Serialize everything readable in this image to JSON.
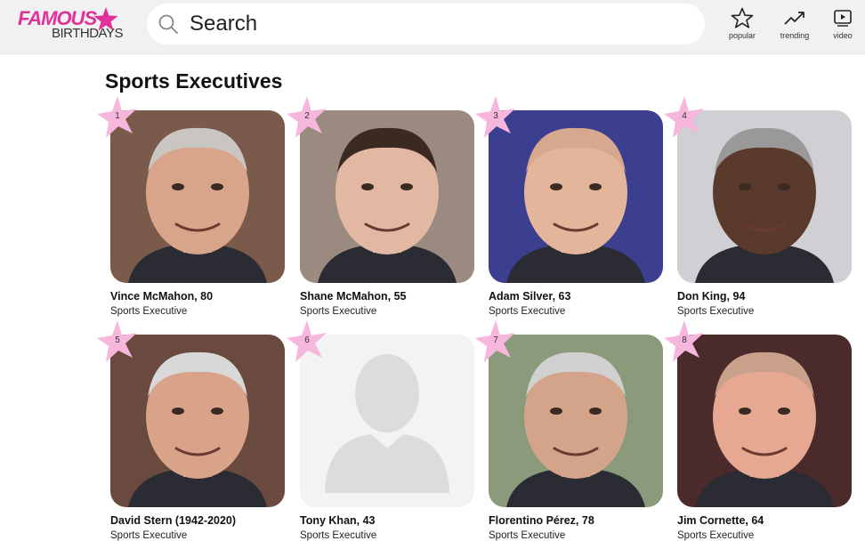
{
  "header": {
    "logo_top": "FAMOUS",
    "logo_bottom": "BIRTHDAYS",
    "search_placeholder": "Search",
    "nav": [
      {
        "label": "popular",
        "icon": "star-outline-icon"
      },
      {
        "label": "trending",
        "icon": "trending-up-icon"
      },
      {
        "label": "video",
        "icon": "play-video-icon"
      }
    ]
  },
  "colors": {
    "brand_pink": "#e0329a",
    "star_pink": "#f7b6dc",
    "header_bg": "#f1f1f1"
  },
  "main": {
    "title": "Sports Executives",
    "people": [
      {
        "rank": "1",
        "name": "Vince McMahon, 80",
        "role": "Sports Executive",
        "bg": "#7a5a4a",
        "skin": "#d9a58a",
        "hair": "#c9c5c0"
      },
      {
        "rank": "2",
        "name": "Shane McMahon, 55",
        "role": "Sports Executive",
        "bg": "#9a8a80",
        "skin": "#e2b8a3",
        "hair": "#3a2a22"
      },
      {
        "rank": "3",
        "name": "Adam Silver, 63",
        "role": "Sports Executive",
        "bg": "#3c3f8f",
        "skin": "#e3b59a",
        "hair": "#d6a98e"
      },
      {
        "rank": "4",
        "name": "Don King, 94",
        "role": "Sports Executive",
        "bg": "#cfcfd4",
        "skin": "#5a3a2c",
        "hair": "#9a9898"
      },
      {
        "rank": "5",
        "name": "David Stern (1942-2020)",
        "role": "Sports Executive",
        "bg": "#6a4a3e",
        "skin": "#d9a38a",
        "hair": "#d8d8d8"
      },
      {
        "rank": "6",
        "name": "Tony Khan, 43",
        "role": "Sports Executive",
        "bg": "#f3f3f3",
        "skin": "#dcdcdc",
        "hair": "#dcdcdc"
      },
      {
        "rank": "7",
        "name": "Florentino Pérez, 78",
        "role": "Sports Executive",
        "bg": "#8a9a7a",
        "skin": "#d4a48a",
        "hair": "#d0d0d0"
      },
      {
        "rank": "8",
        "name": "Jim Cornette, 64",
        "role": "Sports Executive",
        "bg": "#4a2a2a",
        "skin": "#e6a890",
        "hair": "#c9a08a"
      }
    ]
  }
}
